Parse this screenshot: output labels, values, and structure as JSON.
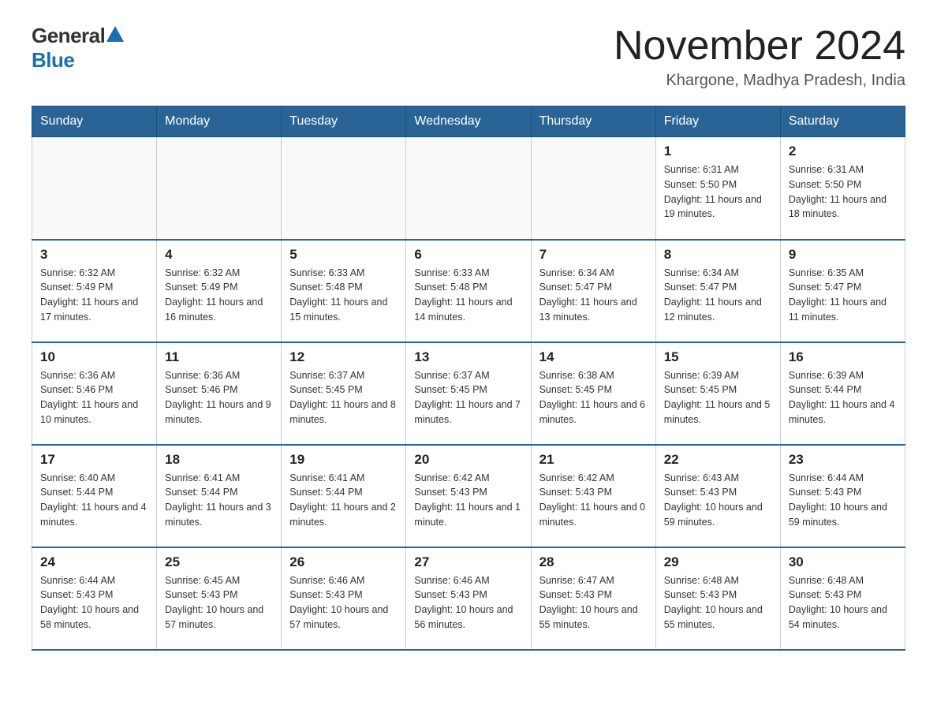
{
  "header": {
    "logo_general": "General",
    "logo_blue": "Blue",
    "month_title": "November 2024",
    "location": "Khargone, Madhya Pradesh, India"
  },
  "days_of_week": [
    "Sunday",
    "Monday",
    "Tuesday",
    "Wednesday",
    "Thursday",
    "Friday",
    "Saturday"
  ],
  "weeks": [
    [
      {
        "day": "",
        "info": ""
      },
      {
        "day": "",
        "info": ""
      },
      {
        "day": "",
        "info": ""
      },
      {
        "day": "",
        "info": ""
      },
      {
        "day": "",
        "info": ""
      },
      {
        "day": "1",
        "info": "Sunrise: 6:31 AM\nSunset: 5:50 PM\nDaylight: 11 hours and 19 minutes."
      },
      {
        "day": "2",
        "info": "Sunrise: 6:31 AM\nSunset: 5:50 PM\nDaylight: 11 hours and 18 minutes."
      }
    ],
    [
      {
        "day": "3",
        "info": "Sunrise: 6:32 AM\nSunset: 5:49 PM\nDaylight: 11 hours and 17 minutes."
      },
      {
        "day": "4",
        "info": "Sunrise: 6:32 AM\nSunset: 5:49 PM\nDaylight: 11 hours and 16 minutes."
      },
      {
        "day": "5",
        "info": "Sunrise: 6:33 AM\nSunset: 5:48 PM\nDaylight: 11 hours and 15 minutes."
      },
      {
        "day": "6",
        "info": "Sunrise: 6:33 AM\nSunset: 5:48 PM\nDaylight: 11 hours and 14 minutes."
      },
      {
        "day": "7",
        "info": "Sunrise: 6:34 AM\nSunset: 5:47 PM\nDaylight: 11 hours and 13 minutes."
      },
      {
        "day": "8",
        "info": "Sunrise: 6:34 AM\nSunset: 5:47 PM\nDaylight: 11 hours and 12 minutes."
      },
      {
        "day": "9",
        "info": "Sunrise: 6:35 AM\nSunset: 5:47 PM\nDaylight: 11 hours and 11 minutes."
      }
    ],
    [
      {
        "day": "10",
        "info": "Sunrise: 6:36 AM\nSunset: 5:46 PM\nDaylight: 11 hours and 10 minutes."
      },
      {
        "day": "11",
        "info": "Sunrise: 6:36 AM\nSunset: 5:46 PM\nDaylight: 11 hours and 9 minutes."
      },
      {
        "day": "12",
        "info": "Sunrise: 6:37 AM\nSunset: 5:45 PM\nDaylight: 11 hours and 8 minutes."
      },
      {
        "day": "13",
        "info": "Sunrise: 6:37 AM\nSunset: 5:45 PM\nDaylight: 11 hours and 7 minutes."
      },
      {
        "day": "14",
        "info": "Sunrise: 6:38 AM\nSunset: 5:45 PM\nDaylight: 11 hours and 6 minutes."
      },
      {
        "day": "15",
        "info": "Sunrise: 6:39 AM\nSunset: 5:45 PM\nDaylight: 11 hours and 5 minutes."
      },
      {
        "day": "16",
        "info": "Sunrise: 6:39 AM\nSunset: 5:44 PM\nDaylight: 11 hours and 4 minutes."
      }
    ],
    [
      {
        "day": "17",
        "info": "Sunrise: 6:40 AM\nSunset: 5:44 PM\nDaylight: 11 hours and 4 minutes."
      },
      {
        "day": "18",
        "info": "Sunrise: 6:41 AM\nSunset: 5:44 PM\nDaylight: 11 hours and 3 minutes."
      },
      {
        "day": "19",
        "info": "Sunrise: 6:41 AM\nSunset: 5:44 PM\nDaylight: 11 hours and 2 minutes."
      },
      {
        "day": "20",
        "info": "Sunrise: 6:42 AM\nSunset: 5:43 PM\nDaylight: 11 hours and 1 minute."
      },
      {
        "day": "21",
        "info": "Sunrise: 6:42 AM\nSunset: 5:43 PM\nDaylight: 11 hours and 0 minutes."
      },
      {
        "day": "22",
        "info": "Sunrise: 6:43 AM\nSunset: 5:43 PM\nDaylight: 10 hours and 59 minutes."
      },
      {
        "day": "23",
        "info": "Sunrise: 6:44 AM\nSunset: 5:43 PM\nDaylight: 10 hours and 59 minutes."
      }
    ],
    [
      {
        "day": "24",
        "info": "Sunrise: 6:44 AM\nSunset: 5:43 PM\nDaylight: 10 hours and 58 minutes."
      },
      {
        "day": "25",
        "info": "Sunrise: 6:45 AM\nSunset: 5:43 PM\nDaylight: 10 hours and 57 minutes."
      },
      {
        "day": "26",
        "info": "Sunrise: 6:46 AM\nSunset: 5:43 PM\nDaylight: 10 hours and 57 minutes."
      },
      {
        "day": "27",
        "info": "Sunrise: 6:46 AM\nSunset: 5:43 PM\nDaylight: 10 hours and 56 minutes."
      },
      {
        "day": "28",
        "info": "Sunrise: 6:47 AM\nSunset: 5:43 PM\nDaylight: 10 hours and 55 minutes."
      },
      {
        "day": "29",
        "info": "Sunrise: 6:48 AM\nSunset: 5:43 PM\nDaylight: 10 hours and 55 minutes."
      },
      {
        "day": "30",
        "info": "Sunrise: 6:48 AM\nSunset: 5:43 PM\nDaylight: 10 hours and 54 minutes."
      }
    ]
  ]
}
